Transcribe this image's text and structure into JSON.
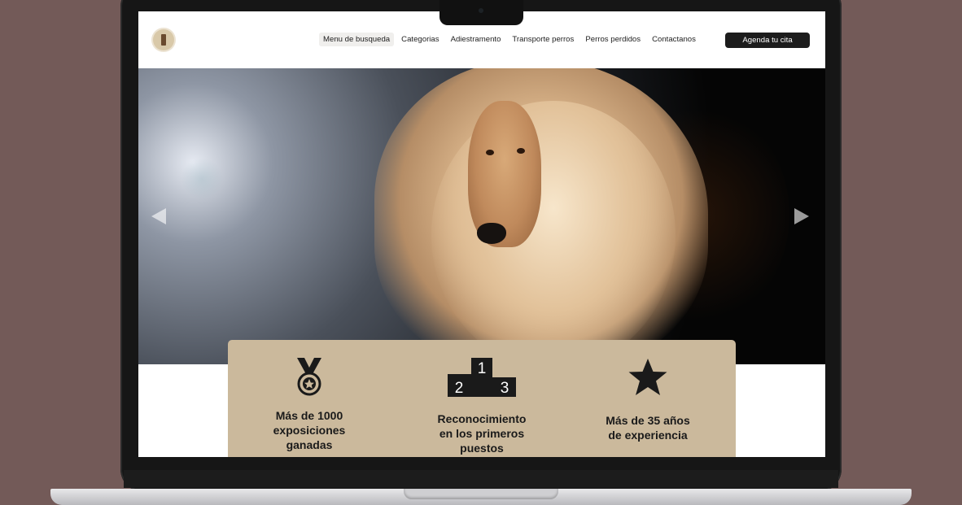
{
  "nav": {
    "items": [
      {
        "label": "Menu de busqueda",
        "active": true
      },
      {
        "label": "Categorias",
        "active": false
      },
      {
        "label": "Adiestramento",
        "active": false
      },
      {
        "label": "Transporte perros",
        "active": false
      },
      {
        "label": "Perros perdidos",
        "active": false
      },
      {
        "label": "Contactanos",
        "active": false
      }
    ],
    "cta_label": "Agenda tu cita"
  },
  "hero": {
    "image": "afghan-hound-photo",
    "prev_icon": "chevron-left-icon",
    "next_icon": "chevron-right-icon"
  },
  "stats": [
    {
      "icon": "medal-icon",
      "text": "Más de 1000 exposiciones ganadas"
    },
    {
      "icon": "podium-icon",
      "text": "Reconocimiento en los primeros puestos",
      "podium_numbers": [
        "1",
        "2",
        "3"
      ]
    },
    {
      "icon": "star-icon",
      "text": "Más de 35 años de experiencia"
    }
  ],
  "colors": {
    "background": "#735a58",
    "card": "#cbb99c",
    "cta": "#1c1c1c"
  }
}
